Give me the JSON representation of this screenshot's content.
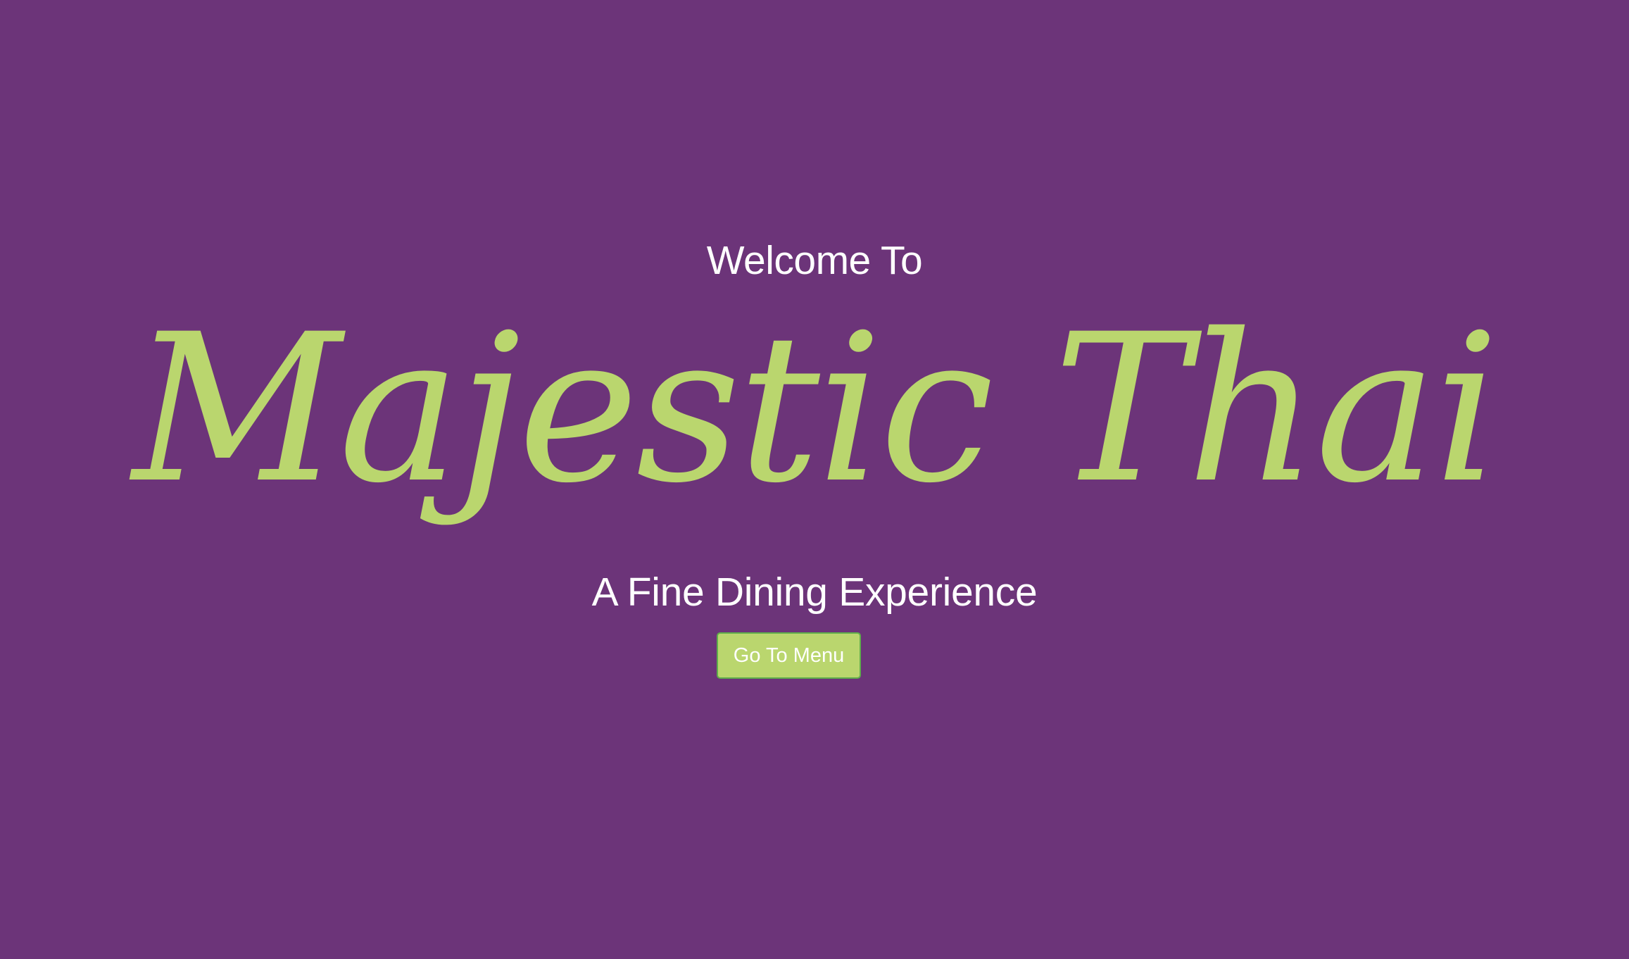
{
  "hero": {
    "welcome_text": "Welcome To",
    "restaurant_name": "Majestic Thai",
    "tagline": "A Fine Dining Experience",
    "menu_button_label": "Go To Menu"
  },
  "colors": {
    "background": "#6c3479",
    "brand_accent": "#bad66e",
    "button_border": "#5fae4a",
    "text": "#ffffff"
  }
}
